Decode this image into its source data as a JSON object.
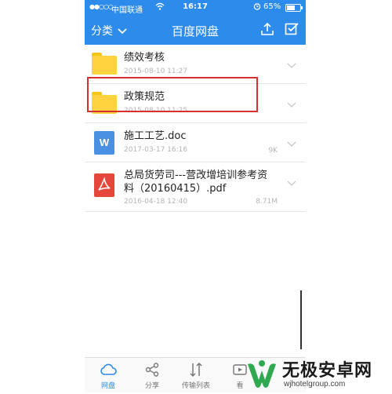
{
  "status_bar": {
    "signal": "●●○○○",
    "carrier": "中国联通",
    "time": "16:17",
    "battery_percent": "65%",
    "battery_level": 0.65
  },
  "nav": {
    "category_label": "分类",
    "title": "百度网盘"
  },
  "files": [
    {
      "name": "绩效考核",
      "date": "2015-08-10 11:27",
      "size": "",
      "type": "folder-icon"
    },
    {
      "name": "政策规范",
      "date": "2015-08-10 11:25",
      "size": "",
      "type": "folder-icon"
    },
    {
      "name": "施工工艺.doc",
      "date": "2017-03-17 16:16",
      "size": "9K",
      "type": "word-doc-icon",
      "icon_letter": "W"
    },
    {
      "name": "总局货劳司---营改增培训参考资料（20160415）.pdf",
      "date": "2016-04-18 12:40",
      "size": "8.71M",
      "type": "pdf-icon"
    }
  ],
  "tabs": [
    {
      "label": "网盘",
      "icon": "cloud-icon",
      "active": true
    },
    {
      "label": "分享",
      "icon": "share-icon",
      "active": false
    },
    {
      "label": "传输列表",
      "icon": "transfer-icon",
      "active": false
    },
    {
      "label": "看",
      "icon": "view-icon",
      "active": false
    }
  ],
  "watermark": {
    "title": "无极安卓网",
    "url": "wjhotelgroup.com"
  },
  "colors": {
    "primary": "#2d8bec",
    "folder": "#ffd23f",
    "word": "#4a90e2",
    "pdf": "#e5483b",
    "highlight": "#d6312f",
    "watermark_green": "#2fa84f"
  }
}
